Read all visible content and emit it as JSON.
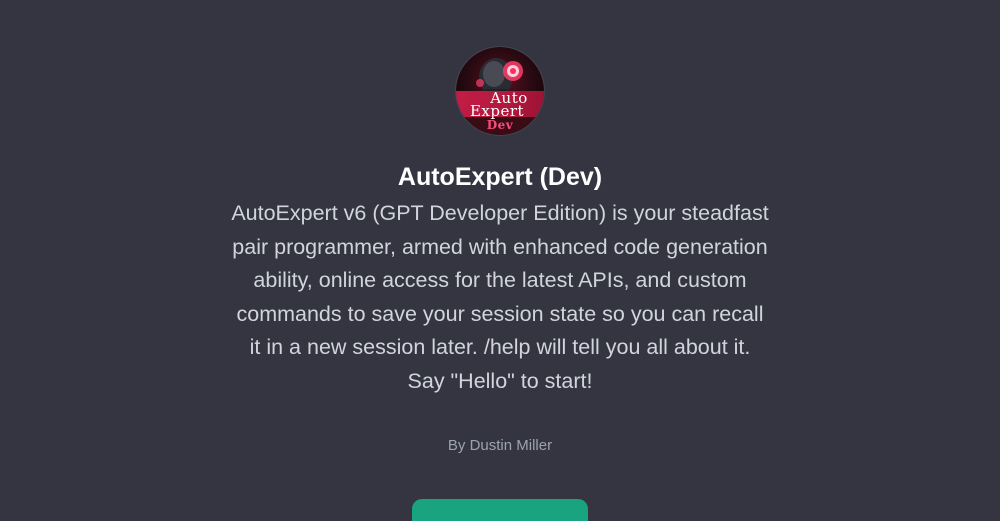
{
  "gpt": {
    "title": "AutoExpert (Dev)",
    "description": "AutoExpert v6 (GPT Developer Edition) is your steadfast pair programmer, armed with enhanced code generation ability, online access for the latest APIs, and custom commands to save your session state so you can recall it in a new session later. /help will tell you all about it. Say \"Hello\" to start!",
    "author": "By Dustin Miller",
    "avatar": {
      "logo_line1": "Auto",
      "logo_line2": "Expert",
      "logo_line3": "Dev"
    }
  },
  "start_button": {
    "label": ""
  },
  "colors": {
    "background": "#343541",
    "title": "#ffffff",
    "description": "#d1d5db",
    "author": "#9ca3af",
    "button": "#19a37f",
    "logo_red": "#b5163c"
  }
}
